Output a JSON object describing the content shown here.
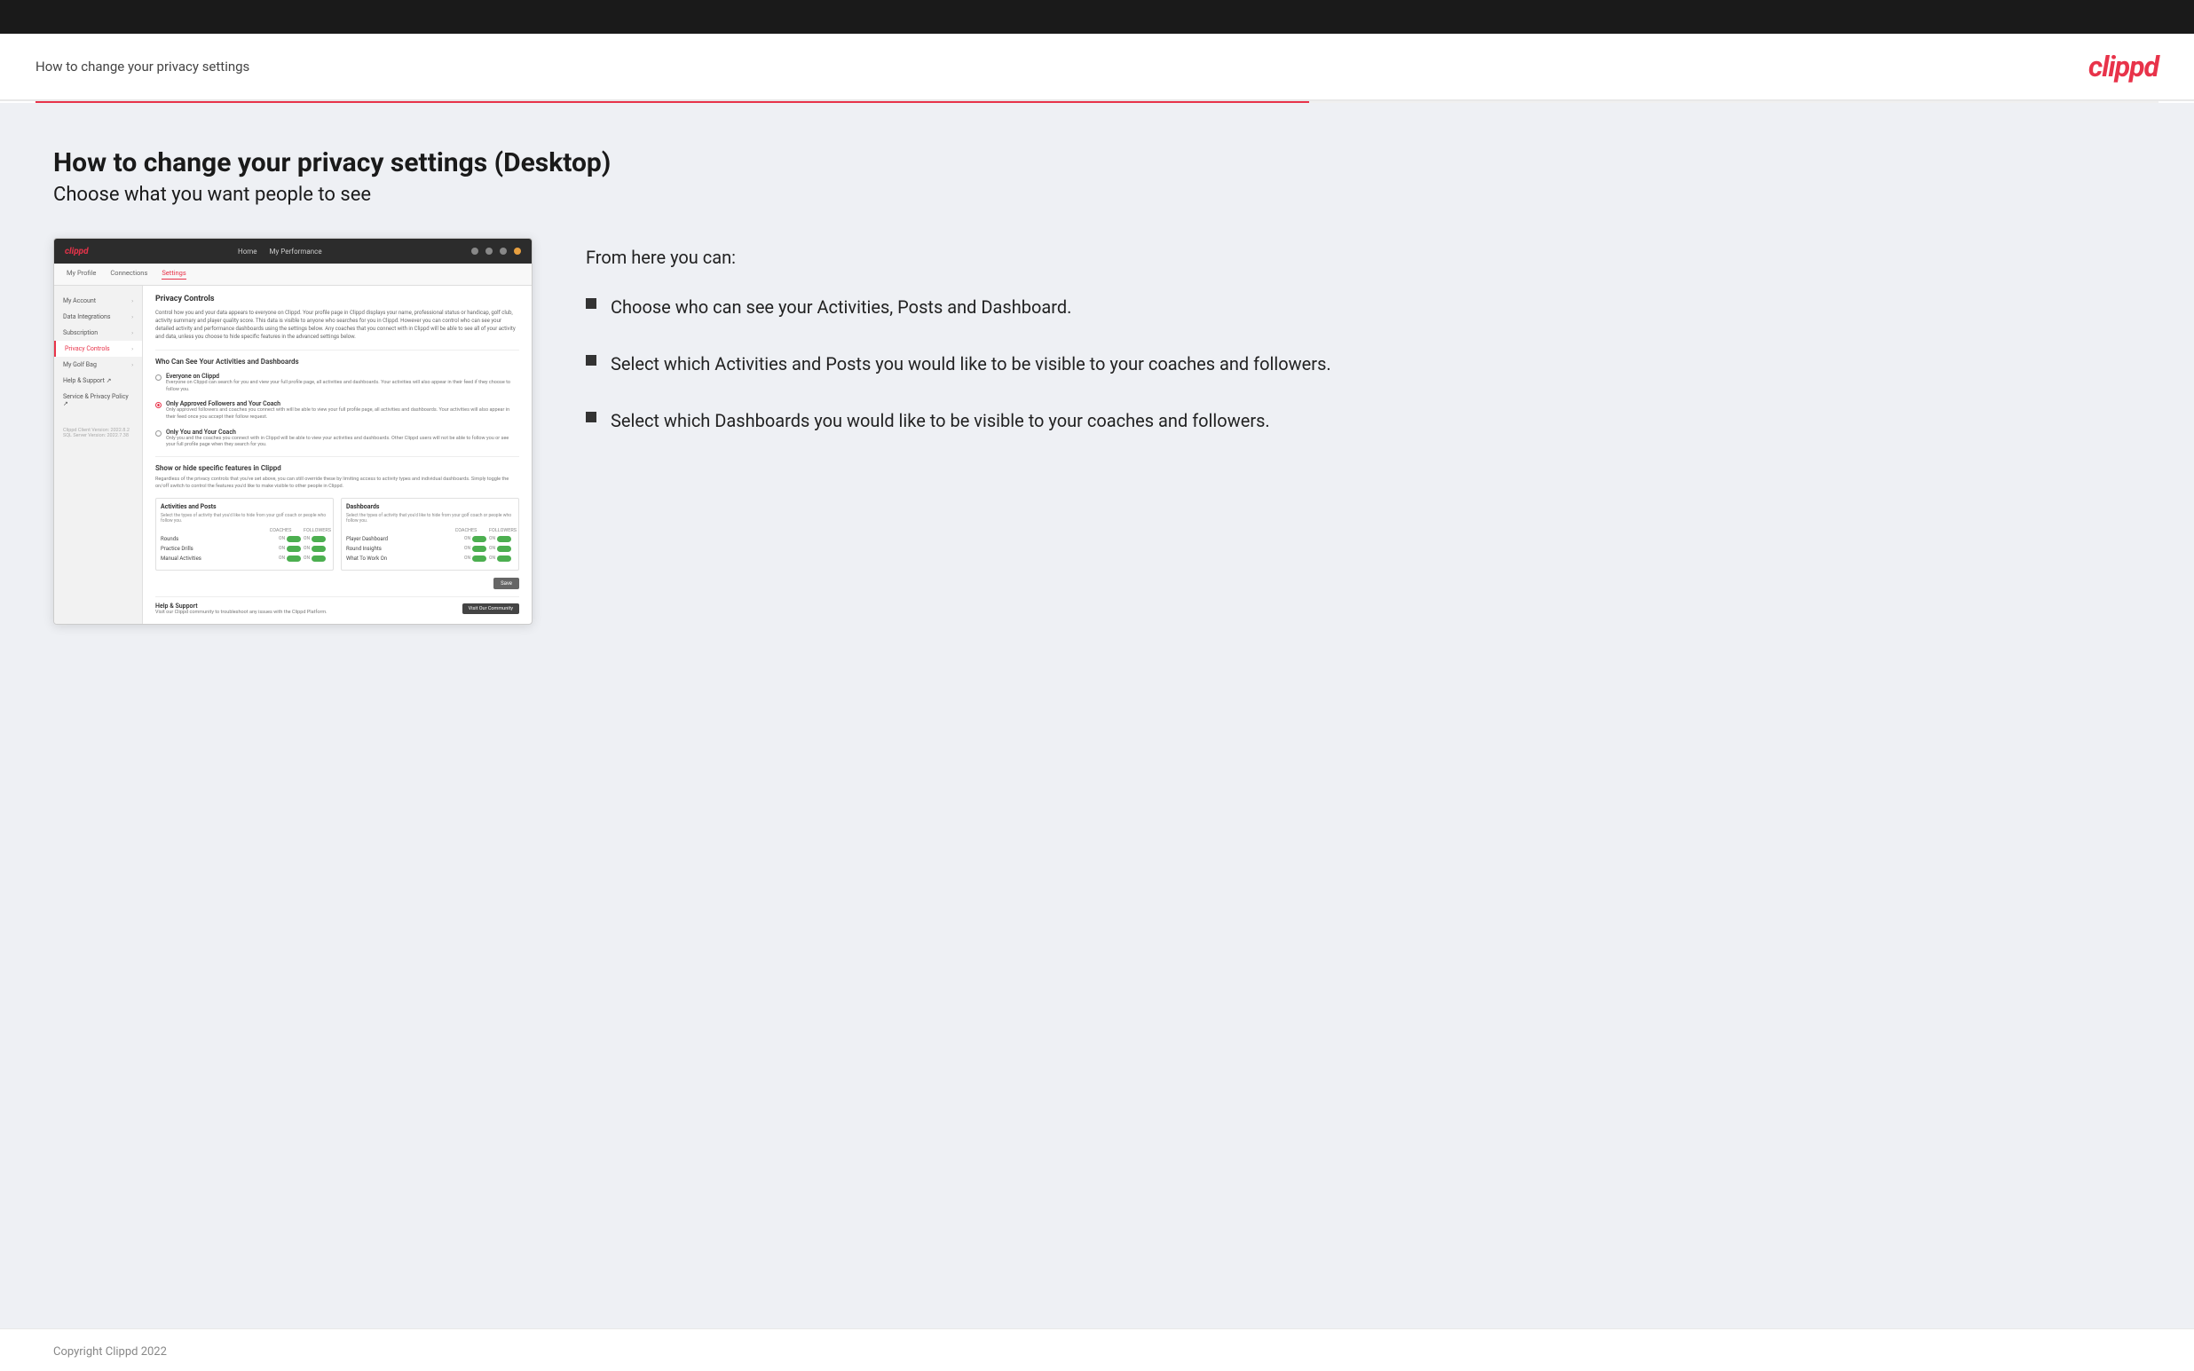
{
  "header": {
    "title": "How to change your privacy settings",
    "logo": "clippd"
  },
  "page": {
    "heading": "How to change your privacy settings (Desktop)",
    "subheading": "Choose what you want people to see"
  },
  "right_panel": {
    "intro": "From here you can:",
    "bullets": [
      "Choose who can see your Activities, Posts and Dashboard.",
      "Select which Activities and Posts you would like to be visible to your coaches and followers.",
      "Select which Dashboards you would like to be visible to your coaches and followers."
    ]
  },
  "mockup": {
    "nav": {
      "logo": "clippd",
      "links": [
        "Home",
        "My Performance"
      ]
    },
    "subnav": {
      "items": [
        "My Profile",
        "Connections",
        "Settings"
      ]
    },
    "sidebar": {
      "items": [
        {
          "label": "My Account",
          "active": false
        },
        {
          "label": "Data Integrations",
          "active": false
        },
        {
          "label": "Subscription",
          "active": false
        },
        {
          "label": "Privacy Controls",
          "active": true
        },
        {
          "label": "My Golf Bag",
          "active": false
        },
        {
          "label": "Help & Support",
          "active": false
        },
        {
          "label": "Service & Privacy Policy",
          "active": false
        }
      ],
      "version": "Clippd Client Version: 2022.8.2\nSQL Server Version: 2022.7.38"
    },
    "main": {
      "privacy_controls_title": "Privacy Controls",
      "privacy_controls_desc": "Control how you and your data appears to everyone on Clippd. Your profile page in Clippd displays your name, professional status or handicap, golf club, activity summary and player quality score. This data is visible to anyone who searches for you in Clippd. However you can control who can see your detailed activity and performance dashboards using the settings below. Any coaches that you connect with in Clippd will be able to see all of your activity and data, unless you choose to hide specific features in the advanced settings below.",
      "who_can_see_title": "Who Can See Your Activities and Dashboards",
      "radio_options": [
        {
          "label": "Everyone on Clippd",
          "desc": "Everyone on Clippd can search for you and view your full profile page, all activities and dashboards. Your activities will also appear in their feed if they choose to follow you.",
          "selected": false
        },
        {
          "label": "Only Approved Followers and Your Coach",
          "desc": "Only approved followers and coaches you connect with will be able to view your full profile page, all activities and dashboards. Your activities will also appear in their feed once you accept their follow request.",
          "selected": true
        },
        {
          "label": "Only You and Your Coach",
          "desc": "Only you and the coaches you connect with in Clippd will be able to view your activities and dashboards. Other Clippd users will not be able to follow you or see your full profile page when they search for you.",
          "selected": false
        }
      ],
      "show_hide_title": "Show or hide specific features in Clippd",
      "show_hide_desc": "Regardless of the privacy controls that you've set above, you can still override these by limiting access to activity types and individual dashboards. Simply toggle the on/off switch to control the features you'd like to make visible to other people in Clippd.",
      "activities_table": {
        "title": "Activities and Posts",
        "subtitle": "Select the types of activity that you'd like to hide from your golf coach or people who follow you.",
        "columns": [
          "COACHES",
          "FOLLOWERS"
        ],
        "rows": [
          {
            "label": "Rounds",
            "coaches": "ON",
            "followers": "ON"
          },
          {
            "label": "Practice Drills",
            "coaches": "ON",
            "followers": "ON"
          },
          {
            "label": "Manual Activities",
            "coaches": "ON",
            "followers": "ON"
          }
        ]
      },
      "dashboards_table": {
        "title": "Dashboards",
        "subtitle": "Select the types of activity that you'd like to hide from your golf coach or people who follow you.",
        "columns": [
          "COACHES",
          "FOLLOWERS"
        ],
        "rows": [
          {
            "label": "Player Dashboard",
            "coaches": "ON",
            "followers": "ON"
          },
          {
            "label": "Round Insights",
            "coaches": "ON",
            "followers": "ON"
          },
          {
            "label": "What To Work On",
            "coaches": "ON",
            "followers": "ON"
          }
        ]
      },
      "save_button": "Save",
      "help_title": "Help & Support",
      "help_desc": "Visit our Clippd community to troubleshoot any issues with the Clippd Platform.",
      "visit_button": "Visit Our Community"
    }
  },
  "footer": {
    "copyright": "Copyright Clippd 2022"
  }
}
